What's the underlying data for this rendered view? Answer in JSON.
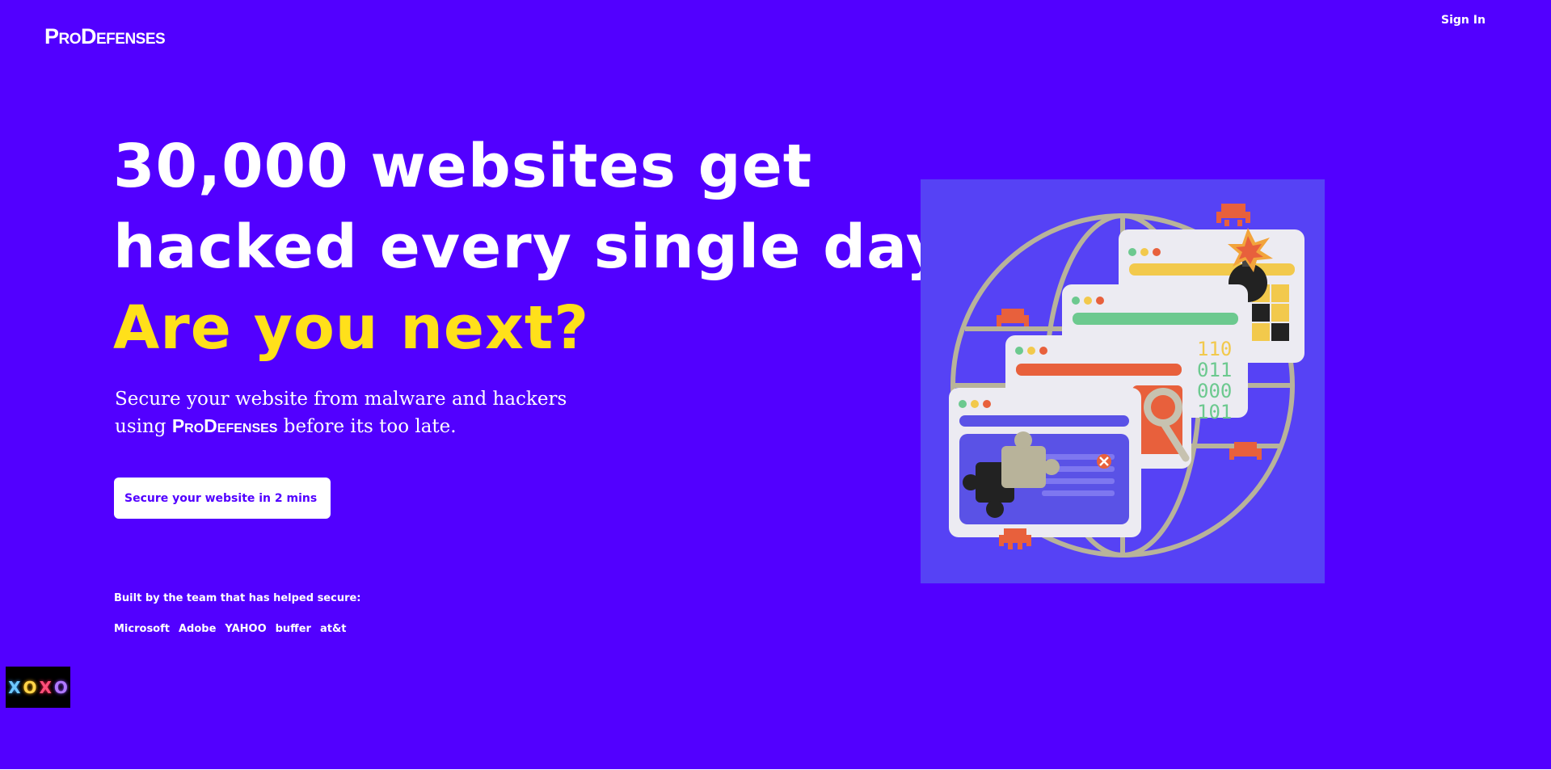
{
  "header": {
    "logo_text": "ProDefenses",
    "signin_label": "Sign In"
  },
  "hero": {
    "headline_line1": "30,000 websites get",
    "headline_line2": "hacked every single day.",
    "headline_line3": "Are you next?",
    "subtitle_part1": "Secure your website from malware and hackers using ",
    "subtitle_brand": "ProDefenses",
    "subtitle_part2": " before its too late.",
    "cta_label": "Secure your website in 2 mins"
  },
  "trust": {
    "built_by": "Built by the team that has helped secure:",
    "clients": [
      "Microsoft",
      "Adobe",
      "YAHOO",
      "buffer",
      "at&t"
    ]
  },
  "badge": {
    "letters": [
      "X",
      "O",
      "X",
      "O"
    ]
  },
  "colors": {
    "background": "#5200ff",
    "accent": "#ffe01a",
    "text": "#ffffff"
  },
  "illustration": {
    "binary_lines": [
      "110",
      "011",
      "000",
      "101"
    ]
  }
}
